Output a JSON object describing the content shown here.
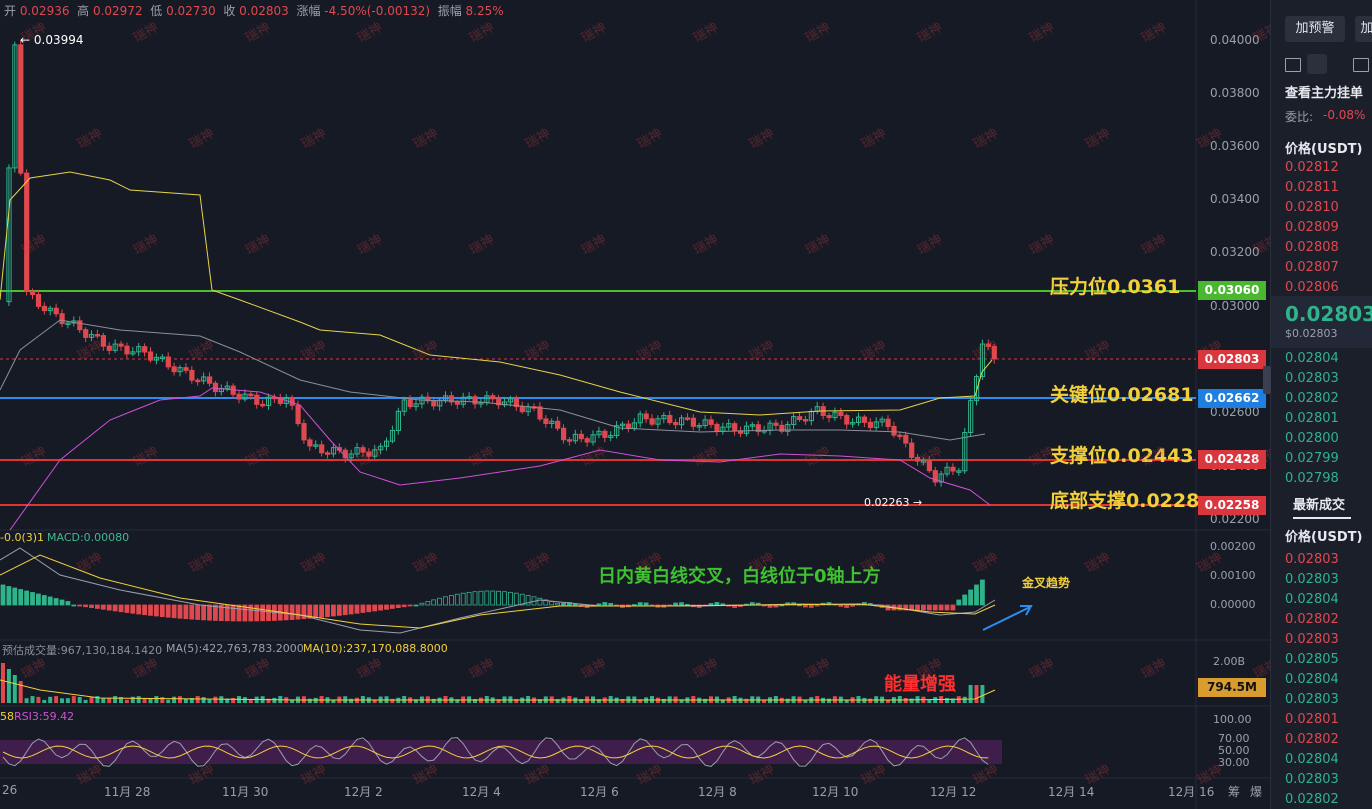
{
  "header": {
    "open_label": "开",
    "open": "0.02936",
    "high_label": "高",
    "high": "0.02972",
    "low_label": "低",
    "low": "0.02730",
    "close_label": "收",
    "close": "0.02803",
    "change_label": "涨幅",
    "change": "-4.50%(-0.00132)",
    "amplitude_label": "振幅",
    "amplitude": "8.25%"
  },
  "price_axis": {
    "ticks": [
      "0.04000",
      "0.03800",
      "0.03600",
      "0.03400",
      "0.03200",
      "0.03000",
      "0.02600",
      "0.02400",
      "0.02200"
    ]
  },
  "high_marker": "← 0.03994",
  "low_marker": "0.02263 →",
  "price_tags": [
    {
      "value": "0.03060",
      "color": "#49b82f"
    },
    {
      "value": "0.02803",
      "color": "#d9363e"
    },
    {
      "value": "0.02662",
      "color": "#1f7fe0"
    },
    {
      "value": "0.02428",
      "color": "#d9363e"
    },
    {
      "value": "0.02258",
      "color": "#d9363e"
    }
  ],
  "levels": [
    {
      "label": "压力位0.0361",
      "color": "#4cbf2a"
    },
    {
      "label": "关键位0.02681",
      "color": "#2d8cf0"
    },
    {
      "label": "支撑位0.02443",
      "color": "#e23333"
    },
    {
      "label": "底部支撑0.0228",
      "color": "#e23333"
    }
  ],
  "macd": {
    "label": "-0.0(3)1",
    "value_label": "MACD:0.00080",
    "ticks": [
      "0.00200",
      "0.00100",
      "0.00000"
    ],
    "annotation": "日内黄白线交叉，白线位于0轴上方",
    "trend_label": "金叉趋势"
  },
  "volume": {
    "label": "预估成交量:967,130,184.1420",
    "ma5": "MA(5):422,763,783.2000",
    "ma10": "MA(10):237,170,088.8000",
    "tick": "2.00B",
    "tag": "794.5M",
    "annotation": "能量增强"
  },
  "rsi": {
    "left_label": "58",
    "label": "RSI3:59.42",
    "ticks": [
      "100.00",
      "70.00",
      "50.00",
      "30.00"
    ]
  },
  "time_axis": [
    "26",
    "11月 28",
    "11月 30",
    "12月 2",
    "12月 4",
    "12月 6",
    "12月 8",
    "12月 10",
    "12月 12",
    "12月 14",
    "12月 16"
  ],
  "time_axis_extra": [
    "筹",
    "爆"
  ],
  "watermark": "瑞神",
  "sidebar": {
    "alert_button": "加预警",
    "add_button": "加",
    "orderbook_title": "查看主力挂单",
    "ratio_label": "委比:",
    "ratio_value": "-0.08%",
    "price_header": "价格(USDT)",
    "asks": [
      "0.02812",
      "0.02811",
      "0.02810",
      "0.02809",
      "0.02808",
      "0.02807",
      "0.02806"
    ],
    "last_price": "0.02803",
    "last_price_sub": "$0.02803",
    "bids": [
      "0.02804",
      "0.02803",
      "0.02802",
      "0.02801",
      "0.02800",
      "0.02799",
      "0.02798"
    ],
    "trades_title": "最新成交",
    "trades_header": "价格(USDT)",
    "trades": [
      {
        "p": "0.02803",
        "c": "#e0484f"
      },
      {
        "p": "0.02803",
        "c": "#2fb38a"
      },
      {
        "p": "0.02804",
        "c": "#2fb38a"
      },
      {
        "p": "0.02802",
        "c": "#e0484f"
      },
      {
        "p": "0.02803",
        "c": "#e0484f"
      },
      {
        "p": "0.02805",
        "c": "#2fb38a"
      },
      {
        "p": "0.02804",
        "c": "#2fb38a"
      },
      {
        "p": "0.02803",
        "c": "#2fb38a"
      },
      {
        "p": "0.02801",
        "c": "#e0484f"
      },
      {
        "p": "0.02802",
        "c": "#e0484f"
      },
      {
        "p": "0.02804",
        "c": "#2fb38a"
      },
      {
        "p": "0.02803",
        "c": "#2fb38a"
      },
      {
        "p": "0.02802",
        "c": "#2fb38a"
      }
    ]
  }
}
